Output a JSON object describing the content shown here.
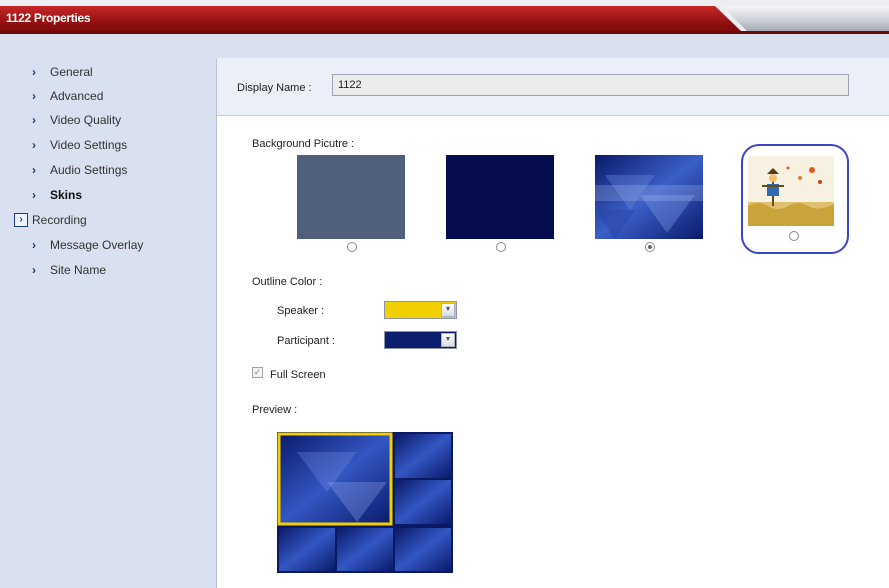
{
  "window": {
    "title": "1122 Properties"
  },
  "sidebar": {
    "items": [
      {
        "label": "General"
      },
      {
        "label": "Advanced"
      },
      {
        "label": "Video Quality"
      },
      {
        "label": "Video Settings"
      },
      {
        "label": "Audio Settings"
      },
      {
        "label": "Skins",
        "active": true
      },
      {
        "label": "Recording",
        "boxed": true
      },
      {
        "label": "Message Overlay"
      },
      {
        "label": "Site Name"
      }
    ]
  },
  "display_name": {
    "label": "Display Name :",
    "value": "1122"
  },
  "background": {
    "label": "Background Picutre :",
    "options": [
      {
        "id": "gray-blue",
        "color": "#4f5f7c",
        "selected": false
      },
      {
        "id": "dark-navy",
        "color": "#050d50",
        "selected": false
      },
      {
        "id": "blue-pattern",
        "color": "#1a2f8c",
        "selected": true
      },
      {
        "id": "scarecrow-image",
        "color": "#e9d7a0",
        "selected": false
      }
    ]
  },
  "outline": {
    "label": "Outline Color :",
    "speaker": {
      "label": "Speaker :",
      "color": "#f2cf00"
    },
    "participant": {
      "label": "Participant :",
      "color": "#0b1f6e"
    }
  },
  "full_screen": {
    "label": "Full Screen",
    "checked": true
  },
  "preview": {
    "label": "Preview :",
    "highlight_color": "#f2cf00"
  }
}
